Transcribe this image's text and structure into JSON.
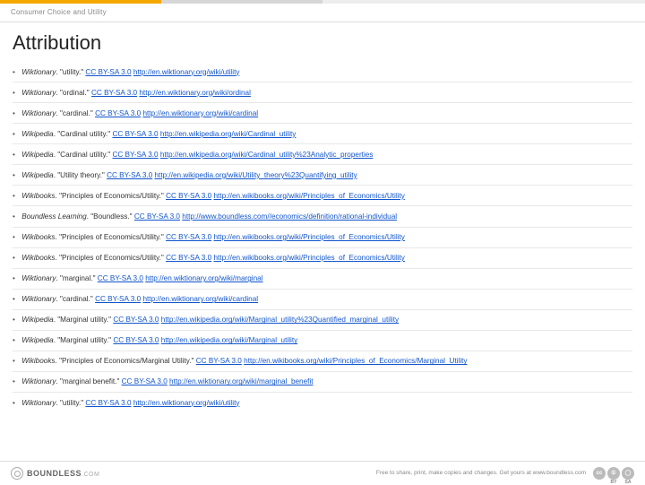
{
  "header": {
    "breadcrumb": "Consumer Choice and Utility"
  },
  "title": "Attribution",
  "license_label": "CC BY-SA 3.0",
  "items": [
    {
      "source": "Wiktionary",
      "title": "utility",
      "url": "http://en.wiktionary.org/wiki/utility"
    },
    {
      "source": "Wiktionary",
      "title": "ordinal",
      "url": "http://en.wiktionary.org/wiki/ordinal"
    },
    {
      "source": "Wiktionary",
      "title": "cardinal",
      "url": "http://en.wiktionary.org/wiki/cardinal"
    },
    {
      "source": "Wikipedia",
      "title": "Cardinal utility",
      "url": "http://en.wikipedia.org/wiki/Cardinal_utility"
    },
    {
      "source": "Wikipedia",
      "title": "Cardinal utility",
      "url": "http://en.wikipedia.org/wiki/Cardinal_utility%23Analytic_properties"
    },
    {
      "source": "Wikipedia",
      "title": "Utility theory",
      "url": "http://en.wikipedia.org/wiki/Utility_theory%23Quantifying_utility"
    },
    {
      "source": "Wikibooks",
      "title": "Principles of Economics/Utility",
      "url": "http://en.wikibooks.org/wiki/Principles_of_Economics/Utility"
    },
    {
      "source": "Boundless Learning",
      "title": "Boundless",
      "url": "http://www.boundless.com//economics/definition/rational-individual"
    },
    {
      "source": "Wikibooks",
      "title": "Principles of Economics/Utility",
      "url": "http://en.wikibooks.org/wiki/Principles_of_Economics/Utility"
    },
    {
      "source": "Wikibooks",
      "title": "Principles of Economics/Utility",
      "url": "http://en.wikibooks.org/wiki/Principles_of_Economics/Utility"
    },
    {
      "source": "Wiktionary",
      "title": "marginal",
      "url": "http://en.wiktionary.org/wiki/marginal"
    },
    {
      "source": "Wiktionary",
      "title": "cardinal",
      "url": "http://en.wiktionary.org/wiki/cardinal"
    },
    {
      "source": "Wikipedia",
      "title": "Marginal utility",
      "url": "http://en.wikipedia.org/wiki/Marginal_utility%23Quantified_marginal_utility"
    },
    {
      "source": "Wikipedia",
      "title": "Marginal utility",
      "url": "http://en.wikipedia.org/wiki/Marginal_utility"
    },
    {
      "source": "Wikibooks",
      "title": "Principles of Economics/Marginal Utility",
      "url": "http://en.wikibooks.org/wiki/Principles_of_Economics/Marginal_Utility"
    },
    {
      "source": "Wiktionary",
      "title": "marginal benefit",
      "url": "http://en.wiktionary.org/wiki/marginal_benefit"
    },
    {
      "source": "Wiktionary",
      "title": "utility",
      "url": "http://en.wiktionary.org/wiki/utility"
    }
  ],
  "footer": {
    "logo_text": "BOUNDLESS",
    "logo_suffix": ".COM",
    "tagline": "Free to share, print, make copies and changes. Get yours at www.boundless.com",
    "cc": [
      "cc",
      "①",
      "◯"
    ],
    "cc_sub": [
      "",
      "BY",
      "SA"
    ]
  }
}
